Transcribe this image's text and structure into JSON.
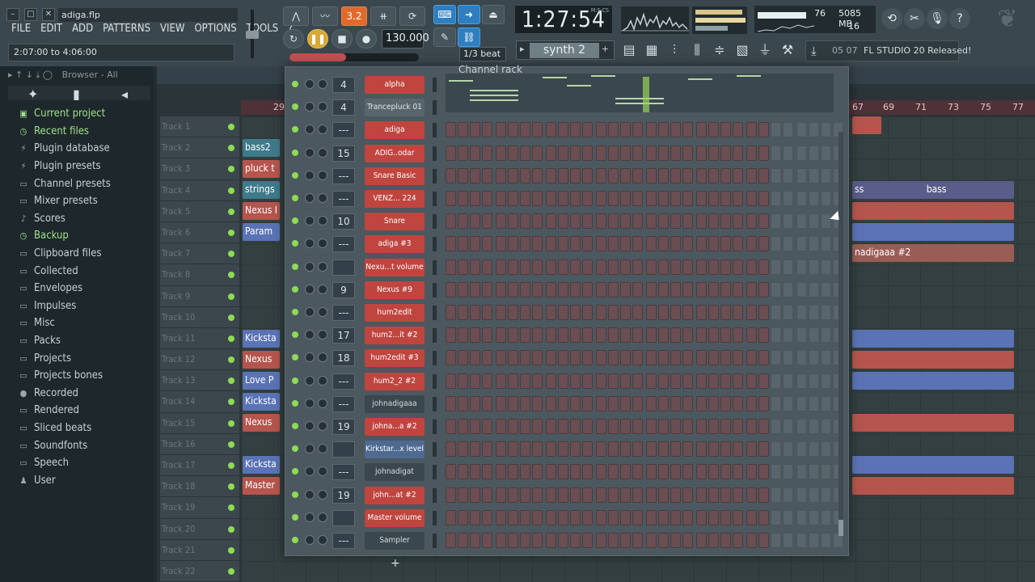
{
  "window": {
    "file_title": "adiga.flp",
    "hint": "2:07:00 to 4:06:00"
  },
  "menu": [
    "FILE",
    "EDIT",
    "ADD",
    "PATTERNS",
    "VIEW",
    "OPTIONS",
    "TOOLS",
    "?"
  ],
  "transport": {
    "pat_label": "3.2",
    "tempo": "130.000",
    "snap": "1/3 beat"
  },
  "time_display": {
    "value": "1:27:54",
    "sub": "M:S:CS"
  },
  "pattern_selector": {
    "name": "synth 2"
  },
  "cpu_panel": {
    "cpu": "76",
    "memory": "5085 MB",
    "polyphony": "16"
  },
  "news": {
    "date": "05 07",
    "text": "FL STUDIO 20 Released!"
  },
  "browser": {
    "header": "Browser - All",
    "items": [
      {
        "label": "Current project",
        "icon": "project-icon",
        "highlight": true
      },
      {
        "label": "Recent files",
        "icon": "clock-icon",
        "highlight": true
      },
      {
        "label": "Plugin database",
        "icon": "plug-icon",
        "highlight": false
      },
      {
        "label": "Plugin presets",
        "icon": "plug-icon",
        "highlight": false
      },
      {
        "label": "Channel presets",
        "icon": "folder-icon",
        "highlight": false
      },
      {
        "label": "Mixer presets",
        "icon": "folder-icon",
        "highlight": false
      },
      {
        "label": "Scores",
        "icon": "note-icon",
        "highlight": false
      },
      {
        "label": "Backup",
        "icon": "backup-icon",
        "highlight": true
      },
      {
        "label": "Clipboard files",
        "icon": "folder-icon",
        "highlight": false
      },
      {
        "label": "Collected",
        "icon": "folder-icon",
        "highlight": false
      },
      {
        "label": "Envelopes",
        "icon": "folder-icon",
        "highlight": false
      },
      {
        "label": "Impulses",
        "icon": "folder-icon",
        "highlight": false
      },
      {
        "label": "Misc",
        "icon": "folder-icon",
        "highlight": false
      },
      {
        "label": "Packs",
        "icon": "folder-icon",
        "highlight": false
      },
      {
        "label": "Projects",
        "icon": "folder-icon",
        "highlight": false
      },
      {
        "label": "Projects bones",
        "icon": "folder-icon",
        "highlight": false
      },
      {
        "label": "Recorded",
        "icon": "mic-icon",
        "highlight": false
      },
      {
        "label": "Rendered",
        "icon": "render-icon",
        "highlight": false
      },
      {
        "label": "Sliced beats",
        "icon": "folder-icon",
        "highlight": false
      },
      {
        "label": "Soundfonts",
        "icon": "folder-icon",
        "highlight": false
      },
      {
        "label": "Speech",
        "icon": "folder-icon",
        "highlight": false
      },
      {
        "label": "User",
        "icon": "user-icon",
        "highlight": false
      }
    ]
  },
  "playlist": {
    "ruler_numbers": [
      "29",
      "67",
      "69",
      "71",
      "73",
      "75",
      "77"
    ],
    "tracks": [
      "Track 1",
      "Track 2",
      "Track 3",
      "Track 4",
      "Track 5",
      "Track 6",
      "Track 7",
      "Track 8",
      "Track 9",
      "Track 10",
      "Track 11",
      "Track 12",
      "Track 13",
      "Track 14",
      "Track 15",
      "Track 16",
      "Track 17",
      "Track 18",
      "Track 19",
      "Track 20",
      "Track 21",
      "Track 22"
    ],
    "clips_left": [
      "bass2",
      "pluck t",
      "strings",
      "Nexus I",
      "Param",
      "Kicksta",
      "Nexus",
      "Love P",
      "Kicksta",
      "Nexus",
      "Kicksta",
      "Master"
    ],
    "clips_right": [
      "ss",
      "bass",
      "nadigaaa #2"
    ]
  },
  "channel_rack": {
    "title": "Channel rack",
    "channels": [
      {
        "num": "4",
        "name": "alpha",
        "color": "red"
      },
      {
        "num": "4",
        "name": "Trancepluck 01",
        "color": "gray"
      },
      {
        "num": "---",
        "name": "adiga",
        "color": "red"
      },
      {
        "num": "15",
        "name": "ADIG..odar",
        "color": "red"
      },
      {
        "num": "---",
        "name": "Snare Basic",
        "color": "red"
      },
      {
        "num": "---",
        "name": "VENZ... 224",
        "color": "red"
      },
      {
        "num": "10",
        "name": "Snare",
        "color": "red"
      },
      {
        "num": "---",
        "name": "adiga #3",
        "color": "red"
      },
      {
        "num": "",
        "name": "Nexu...t volume",
        "color": "red"
      },
      {
        "num": "9",
        "name": "Nexus #9",
        "color": "red"
      },
      {
        "num": "---",
        "name": "hum2edit",
        "color": "red"
      },
      {
        "num": "17",
        "name": "hum2...it #2",
        "color": "red"
      },
      {
        "num": "18",
        "name": "hum2edit #3",
        "color": "red"
      },
      {
        "num": "---",
        "name": "hum2_2 #2",
        "color": "red"
      },
      {
        "num": "---",
        "name": "johnadigaaa",
        "color": "dark"
      },
      {
        "num": "19",
        "name": "johna...a #2",
        "color": "red"
      },
      {
        "num": "",
        "name": "Kirkstar...x level",
        "color": "blue"
      },
      {
        "num": "---",
        "name": "johnadigat",
        "color": "dark"
      },
      {
        "num": "19",
        "name": "john...at #2",
        "color": "red"
      },
      {
        "num": "",
        "name": "Master volume",
        "color": "red"
      },
      {
        "num": "---",
        "name": "Sampler",
        "color": "dark"
      }
    ],
    "add_label": "+"
  }
}
